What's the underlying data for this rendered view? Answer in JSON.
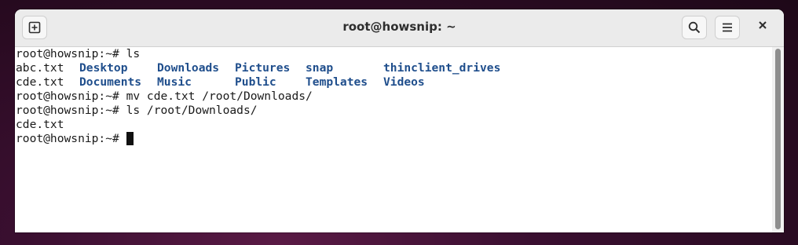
{
  "window": {
    "title": "root@howsnip: ~"
  },
  "icons": {
    "new_tab": "new-tab-icon",
    "search": "search-icon",
    "menu": "hamburger-menu-icon",
    "close": "close-icon"
  },
  "terminal": {
    "lines": [
      {
        "text": "root@howsnip:~# ls"
      },
      {
        "file1": "abc.txt",
        "dirs": [
          "Desktop",
          "Downloads",
          "Pictures",
          "snap",
          "thinclient_drives"
        ]
      },
      {
        "file1": "cde.txt",
        "dirs": [
          "Documents",
          "Music",
          "Public",
          "Templates",
          "Videos"
        ]
      },
      {
        "text": "root@howsnip:~# mv cde.txt /root/Downloads/"
      },
      {
        "text": "root@howsnip:~# ls /root/Downloads/"
      },
      {
        "text": "cde.txt"
      },
      {
        "text": "root@howsnip:~# "
      }
    ],
    "dir_color": "#1f4e8c",
    "text_color": "#1a1a1a"
  }
}
